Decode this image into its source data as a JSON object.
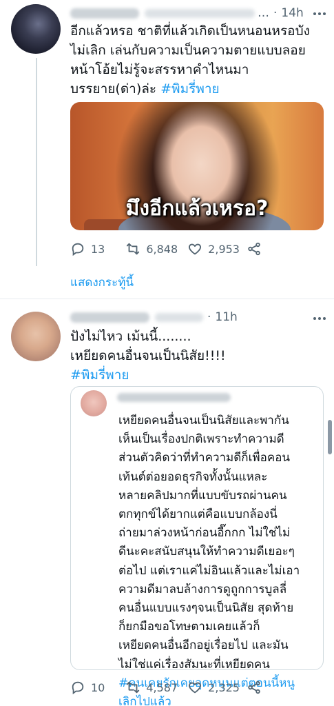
{
  "tweet1": {
    "time": "14h",
    "text": "อีกแล้วหรอ ชาติที่แล้วเกิดเป็นหนอนหรอบัง\nไม่เลิก เล่นกับความเป็นความตายแบบลอย\nหน้าโอ้ยไม่รู้จะสรรหาคำไหนมา\nบรรยาย(ด่า)ล่ะ ",
    "hashtag": "#พิมรี่พาย",
    "media_caption": "มึงอีกแล้วเหรอ?",
    "replies": "13",
    "retweets": "6,848",
    "likes": "2,953",
    "show_thread": "แสดงกระทู้นี้"
  },
  "tweet2": {
    "time": "11h",
    "text": "ปังไม่ไหว เม้นนี้........\nเหยียดคนอื่นจนเป็นนิสัย!!!!",
    "hashtag": "#พิมรี่พาย",
    "replies": "10",
    "retweets": "4,587",
    "likes": "2,325",
    "quote": {
      "text": "เหยียดคนอื่นจนเป็นนิสัยและพากัน\nเห็นเป็นเรื่องปกติเพราะทำความดี\nส่วนตัวคิดว่าที่ทำความดีก็เพื่อคอน\nเท้นต์ต่อยอดธุรกิจทั้งนั้นแหละ\nหลายคลิปมากที่แบบขับรถผ่านคน\nตกทุกข์ได้ยากแต่คือแบบกล้องนี่\nถ่ายมาล่วงหน้าก่อนอี๊กกก ไม่ใช่ไม่\nดีนะคะสนับสนุนให้ทำความดีเยอะๆ\nต่อไป แต่เราแค่ไม่อินแล้วและไม่เอา\nความดีมาลบล้างการดูถูกการบูลลี่\nคนอื่นแบบแรงๆจนเป็นนิสัย สุดท้าย\nก็ยกมือขอโทษตามเคยแล้วก็\nเหยียดคนอื่นอีกอยู่เรื่อยไป และมัน\nไม่ใช่แค่เรื่องสัมนะที่เหยียดคน\n",
      "hashtag": "#คนเคยรักเคยอุดหนุนแต่ตอนนี้หนู\nเลิกไปแล้ว"
    }
  },
  "colors": {
    "accent": "#1d9bf0",
    "secondary_text": "#536471",
    "border": "#cfd9de"
  }
}
